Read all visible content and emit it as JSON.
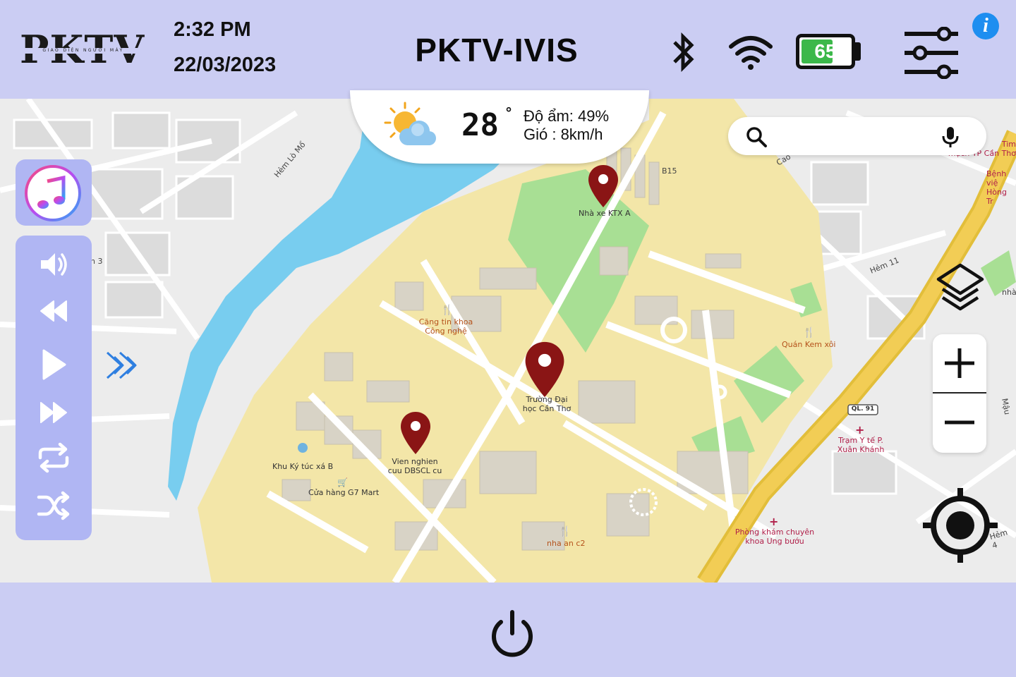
{
  "header": {
    "logo_text": "PKTV",
    "logo_subtitle": "GIAO DIỆN NGƯỜI MÁY",
    "time": "2:32 PM",
    "date": "22/03/2023",
    "title": "PKTV-IVIS",
    "battery_level": "65",
    "battery_fraction": 0.65,
    "icons": [
      "bluetooth-icon",
      "wifi-icon",
      "battery-icon",
      "settings-sliders-icon",
      "info-icon"
    ],
    "info_label": "i"
  },
  "weather": {
    "icon": "partly-cloudy-sun-icon",
    "temperature": "28",
    "degree_symbol": "°",
    "humidity": "Độ ẩm: 49%",
    "wind": "Gió : 8km/h"
  },
  "search": {
    "placeholder": "",
    "value": ""
  },
  "map": {
    "places": [
      {
        "name": "Nhà xe KTX A"
      },
      {
        "name": "Trường Đại\nhọc Cần Thơ"
      },
      {
        "name": "Vien nghien\ncuu DBSCL cu"
      },
      {
        "name": "Căng tin khoa\nCông nghệ"
      },
      {
        "name": "Khu Ký túc xá B"
      },
      {
        "name": "Cửa hàng G7 Mart"
      },
      {
        "name": "nha an c2"
      },
      {
        "name": "Quán Kem xôi"
      },
      {
        "name": "Trạm Y tế P.\nXuân Khánh"
      },
      {
        "name": "Phòng khám chuyên\nkhoa Ung bướu"
      },
      {
        "name": "Bệnh việ\nHòng Tr"
      },
      {
        "name": "Tim\nmạch TP Cần Thơ"
      }
    ],
    "streets": [
      "Hẻm Lò Mổ",
      "Hẻm 11",
      "Hẻm 4",
      "Cao",
      "QL. 91",
      "Mậu",
      "n 3",
      "B15",
      "nhà"
    ],
    "colors": {
      "campus": "#f3e6a8",
      "water": "#78cdef",
      "park": "#a8df94",
      "highway": "#f2cd55",
      "pin": "#8a1515"
    }
  },
  "media": {
    "music_app_icon": "music-note-icon",
    "controls": [
      "volume-icon",
      "rewind-icon",
      "play-icon",
      "fast-forward-icon",
      "repeat-icon",
      "shuffle-icon"
    ],
    "expand_icon": "double-chevron-right-icon"
  },
  "map_controls": [
    "layers-icon",
    "zoom-in-icon",
    "zoom-out-icon",
    "locate-icon"
  ],
  "footer": {
    "power_icon": "power-icon"
  }
}
